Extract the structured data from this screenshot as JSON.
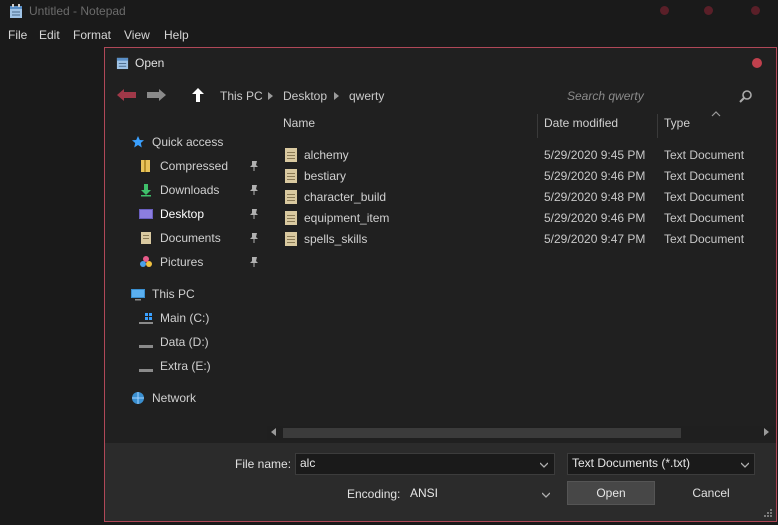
{
  "notepad": {
    "title": "Untitled - Notepad",
    "menu": [
      "File",
      "Edit",
      "Format",
      "View",
      "Help"
    ]
  },
  "dialog": {
    "title": "Open",
    "breadcrumb": [
      "This PC",
      "Desktop",
      "qwerty"
    ],
    "search_placeholder": "Search qwerty",
    "sidebar": {
      "quick_access": "Quick access",
      "quick_items": [
        "Compressed",
        "Downloads",
        "Desktop",
        "Documents",
        "Pictures"
      ],
      "this_pc": "This PC",
      "drives": [
        "Main (C:)",
        "Data (D:)",
        "Extra (E:)"
      ],
      "network": "Network"
    },
    "columns": {
      "name": "Name",
      "date": "Date modified",
      "type": "Type"
    },
    "files": [
      {
        "name": "alchemy",
        "date": "5/29/2020 9:45 PM",
        "type": "Text Document"
      },
      {
        "name": "bestiary",
        "date": "5/29/2020 9:46 PM",
        "type": "Text Document"
      },
      {
        "name": "character_build",
        "date": "5/29/2020 9:48 PM",
        "type": "Text Document"
      },
      {
        "name": "equipment_item",
        "date": "5/29/2020 9:46 PM",
        "type": "Text Document"
      },
      {
        "name": "spells_skills",
        "date": "5/29/2020 9:47 PM",
        "type": "Text Document"
      }
    ],
    "file_name_label": "File name:",
    "file_name_value": "alc",
    "file_type_value": "Text Documents (*.txt)",
    "encoding_label": "Encoding:",
    "encoding_value": "ANSI",
    "open_button": "Open",
    "cancel_button": "Cancel"
  },
  "colors": {
    "accent_border": "#b04858",
    "close_red": "#c0404d",
    "background": "#1a1a1a",
    "panel": "#2b2b2b"
  }
}
